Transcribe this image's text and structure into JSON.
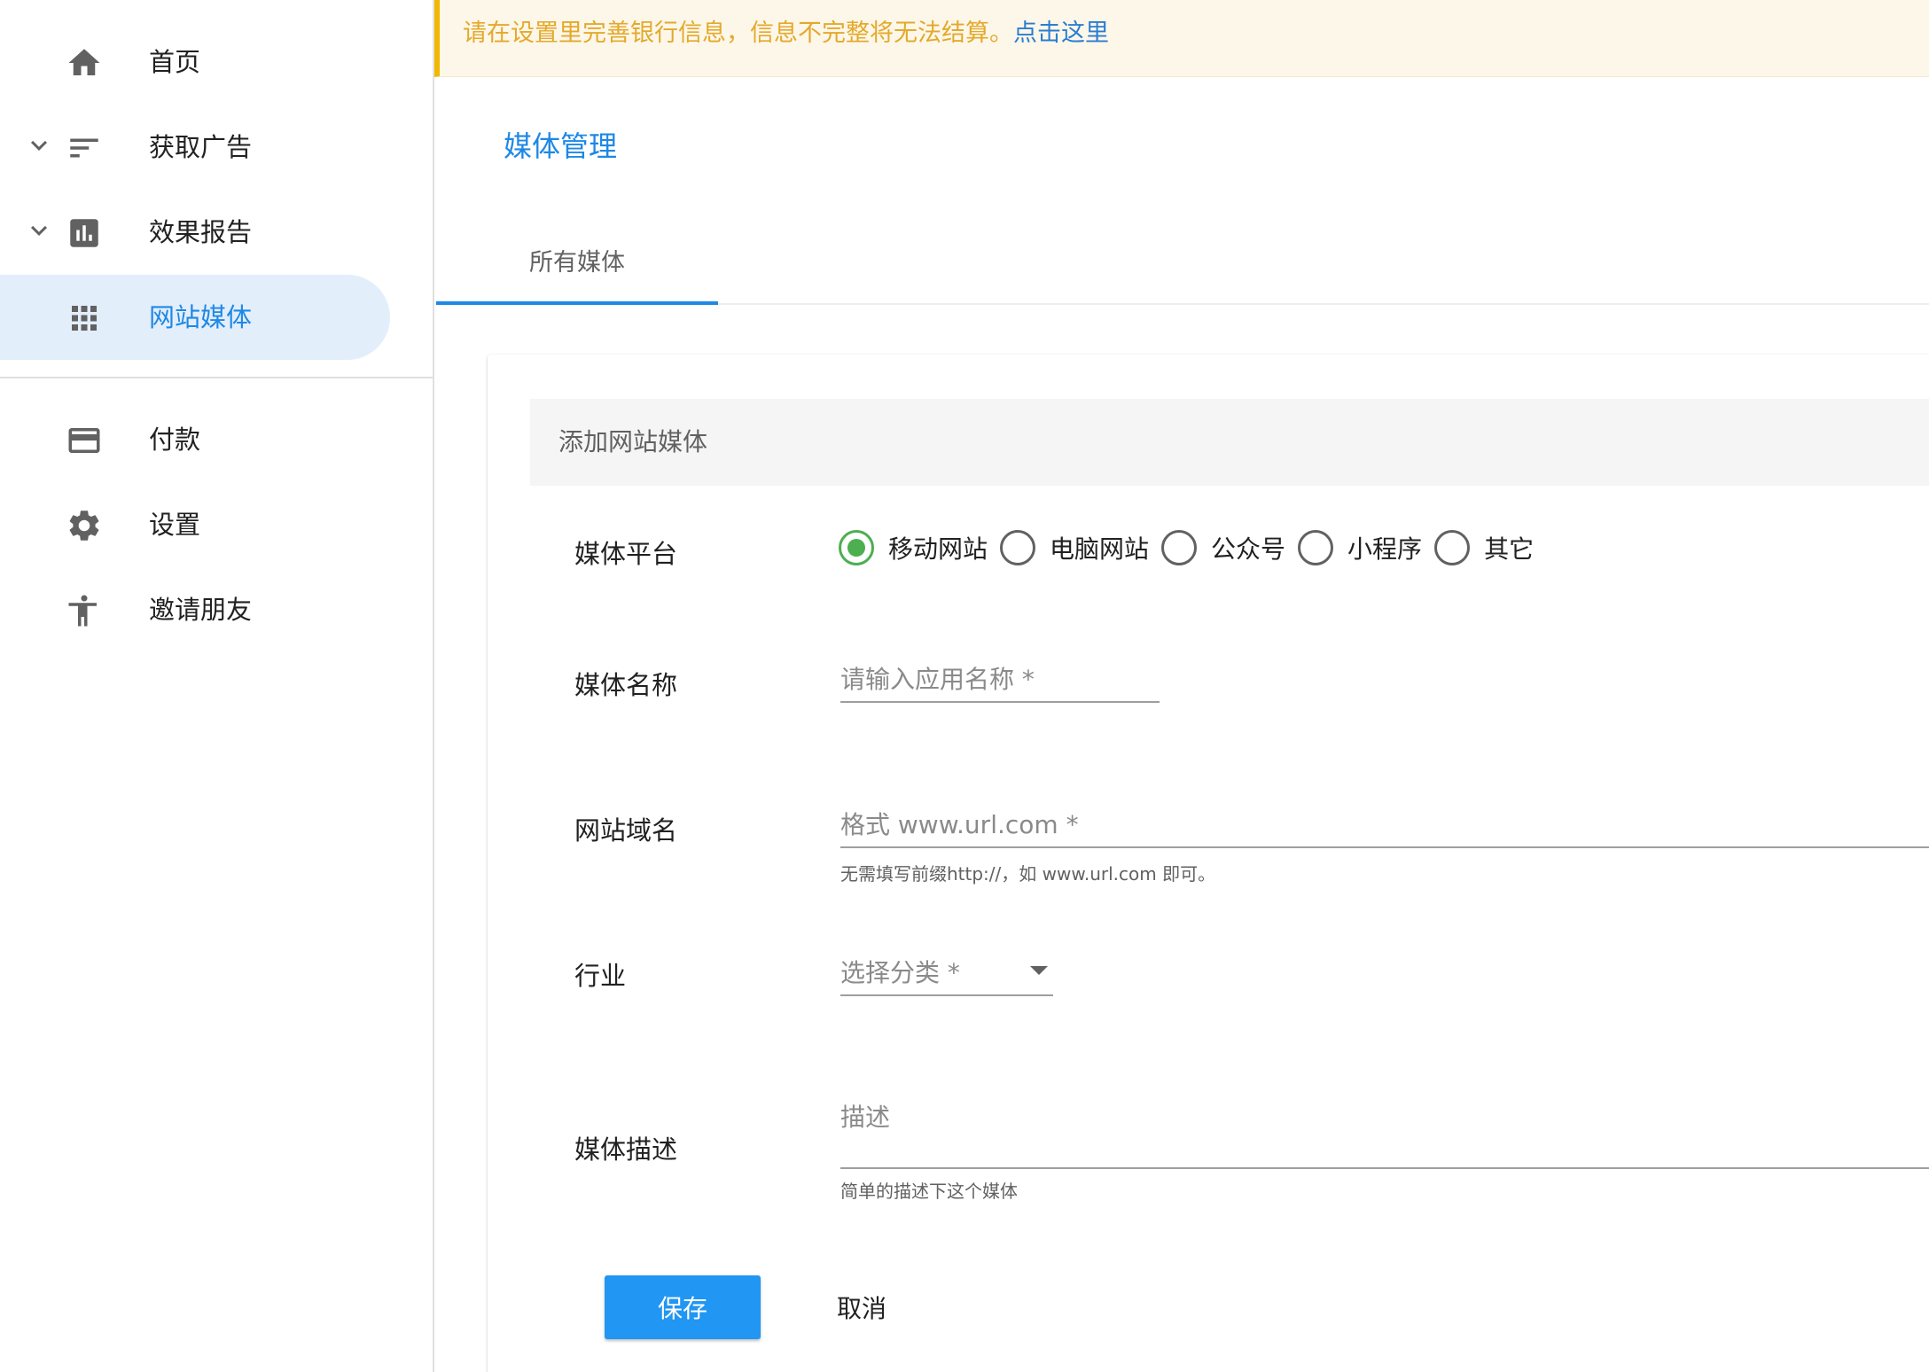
{
  "sidebar": {
    "items": [
      {
        "label": "首页",
        "icon": "home-icon"
      },
      {
        "label": "获取广告",
        "icon": "sort-lines-icon",
        "expandable": true
      },
      {
        "label": "效果报告",
        "icon": "bar-chart-icon",
        "expandable": true
      },
      {
        "label": "网站媒体",
        "icon": "apps-grid-icon",
        "active": true
      },
      {
        "label": "付款",
        "icon": "credit-card-icon"
      },
      {
        "label": "设置",
        "icon": "gear-icon"
      },
      {
        "label": "邀请朋友",
        "icon": "person-icon"
      }
    ]
  },
  "banner": {
    "message": "请在设置里完善银行信息，信息不完整将无法结算。",
    "link": "点击这里"
  },
  "page": {
    "title": "媒体管理",
    "tabs": [
      {
        "label": "所有媒体",
        "active": true
      }
    ]
  },
  "form": {
    "header": "添加网站媒体",
    "platform": {
      "label": "媒体平台",
      "options": [
        "移动网站",
        "电脑网站",
        "公众号",
        "小程序",
        "其它"
      ],
      "selected": "移动网站"
    },
    "name": {
      "label": "媒体名称",
      "placeholder": "请输入应用名称 *",
      "value": ""
    },
    "domain": {
      "label": "网站域名",
      "placeholder": "格式 www.url.com *",
      "hint": "无需填写前缀http://，如 www.url.com 即可。",
      "value": ""
    },
    "industry": {
      "label": "行业",
      "placeholder": "选择分类 *"
    },
    "description": {
      "label": "媒体描述",
      "placeholder": "描述",
      "hint": "简单的描述下这个媒体",
      "value": ""
    },
    "save_label": "保存",
    "cancel_label": "取消"
  },
  "colors": {
    "accent": "#1e88e5",
    "primary_button": "#2196f3",
    "radio_checked": "#4caf50",
    "banner_bg": "#fdf7e9",
    "banner_text": "#e4a92b",
    "banner_border": "#f2b705",
    "active_nav_bg": "#e3eefb"
  }
}
